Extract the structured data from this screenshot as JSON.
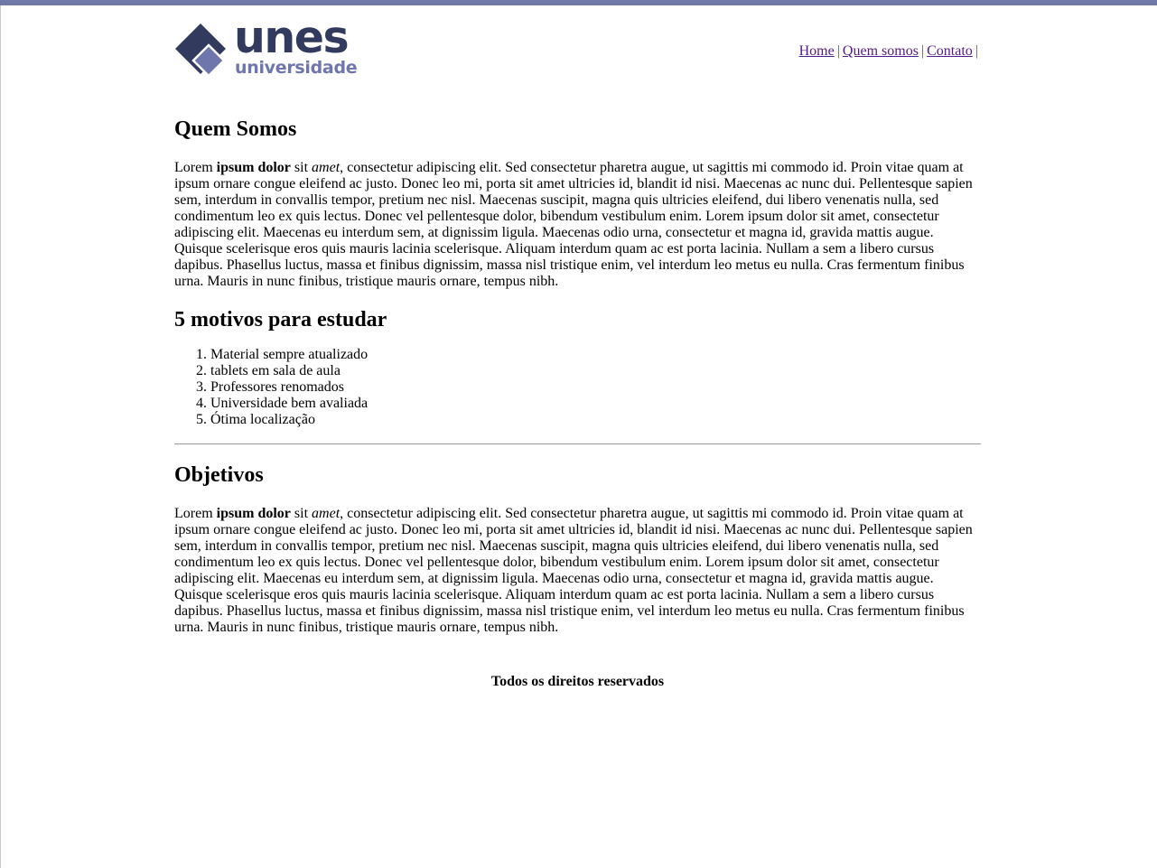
{
  "colors": {
    "top_bar": "#7078a8",
    "logo_dark": "#323a5e",
    "logo_light": "#6f76ab",
    "link": "#551a8b"
  },
  "logo": {
    "title": "unes",
    "subtitle": "universidade"
  },
  "nav": {
    "items": [
      {
        "label": "Home"
      },
      {
        "label": "Quem somos"
      },
      {
        "label": "Contato"
      }
    ],
    "separator": "|"
  },
  "sections": {
    "quem_somos": {
      "title": "Quem Somos",
      "lead1": "Lorem ",
      "bold": "ipsum dolor",
      "lead2": " sit ",
      "italic": "amet",
      "text": ", consectetur adipiscing elit. Sed consectetur pharetra augue, ut sagittis mi commodo id. Proin vitae quam at ipsum ornare congue eleifend ac justo. Donec leo mi, porta sit amet ultricies id, blandit id nisi. Maecenas ac nunc dui. Pellentesque sapien sem, interdum in convallis tempor, pretium nec nisl. Maecenas suscipit, magna quis ultricies eleifend, dui libero venenatis nulla, sed condimentum leo ex quis lectus. Donec vel pellentesque dolor, bibendum vestibulum enim. Lorem ipsum dolor sit amet, consectetur adipiscing elit. Maecenas eu interdum sem, at dignissim ligula. Maecenas odio urna, consectetur et magna id, gravida mattis augue. Quisque scelerisque eros quis mauris lacinia scelerisque. Aliquam interdum quam ac est porta lacinia. Nullam a sem a libero cursus dapibus. Phasellus luctus, massa et finibus dignissim, massa nisl tristique enim, vel interdum leo metus eu nulla. Cras fermentum finibus urna. Mauris in nunc finibus, tristique mauris ornare, tempus nibh."
    },
    "motivos": {
      "title": "5 motivos para estudar",
      "items": [
        "Material sempre atualizado",
        "tablets em sala de aula",
        "Professores renomados",
        "Universidade bem avaliada",
        "Ótima localização"
      ]
    },
    "objetivos": {
      "title": "Objetivos",
      "lead1": "Lorem ",
      "bold": "ipsum dolor",
      "lead2": " sit ",
      "italic": "amet",
      "text": ", consectetur adipiscing elit. Sed consectetur pharetra augue, ut sagittis mi commodo id. Proin vitae quam at ipsum ornare congue eleifend ac justo. Donec leo mi, porta sit amet ultricies id, blandit id nisi. Maecenas ac nunc dui. Pellentesque sapien sem, interdum in convallis tempor, pretium nec nisl. Maecenas suscipit, magna quis ultricies eleifend, dui libero venenatis nulla, sed condimentum leo ex quis lectus. Donec vel pellentesque dolor, bibendum vestibulum enim. Lorem ipsum dolor sit amet, consectetur adipiscing elit. Maecenas eu interdum sem, at dignissim ligula. Maecenas odio urna, consectetur et magna id, gravida mattis augue. Quisque scelerisque eros quis mauris lacinia scelerisque. Aliquam interdum quam ac est porta lacinia. Nullam a sem a libero cursus dapibus. Phasellus luctus, massa et finibus dignissim, massa nisl tristique enim, vel interdum leo metus eu nulla. Cras fermentum finibus urna. Mauris in nunc finibus, tristique mauris ornare, tempus nibh."
    }
  },
  "footer": {
    "text": "Todos os direitos reservados"
  }
}
